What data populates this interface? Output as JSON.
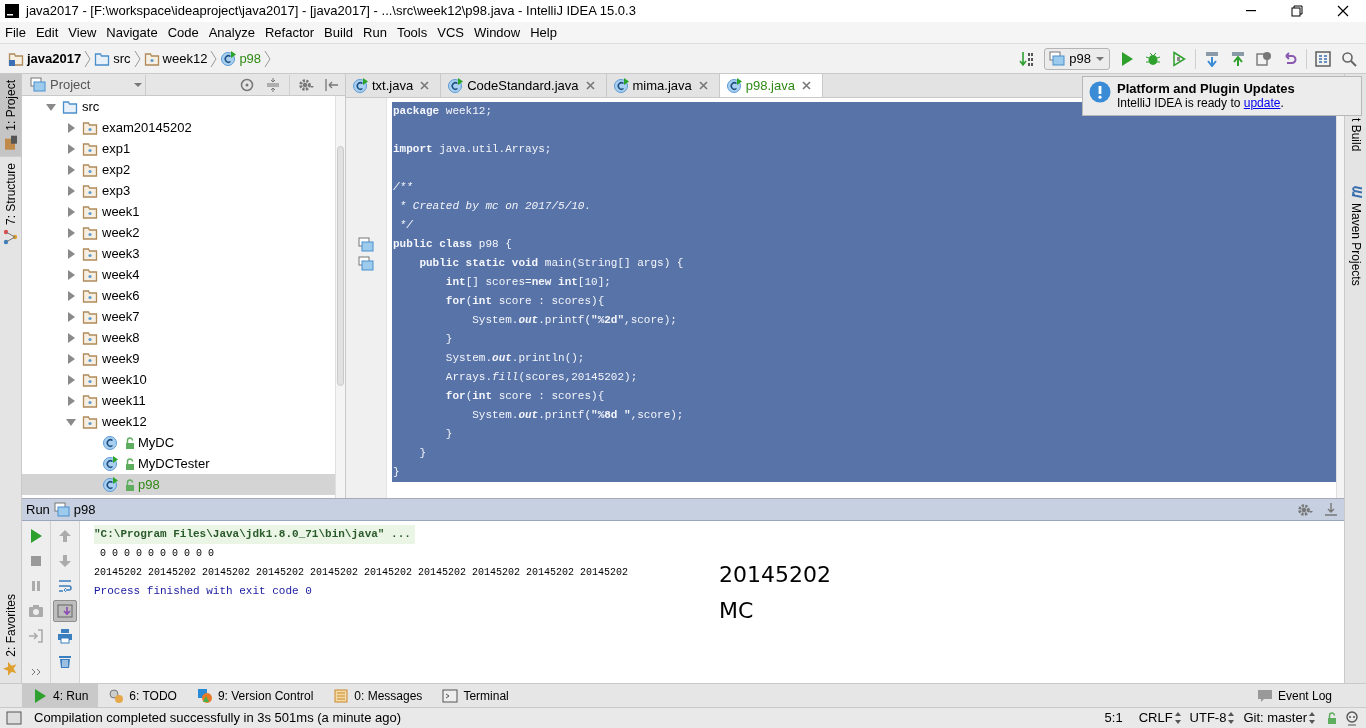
{
  "window": {
    "title": "java2017 - [F:\\workspace\\ideaproject\\java2017] - [java2017] - ...\\src\\week12\\p98.java - IntelliJ IDEA 15.0.3"
  },
  "menu": [
    "File",
    "Edit",
    "View",
    "Navigate",
    "Code",
    "Analyze",
    "Refactor",
    "Build",
    "Run",
    "Tools",
    "VCS",
    "Window",
    "Help"
  ],
  "breadcrumbs": [
    {
      "label": "java2017",
      "kind": "module",
      "color": "#000000"
    },
    {
      "label": "src",
      "kind": "source",
      "color": "#000000"
    },
    {
      "label": "week12",
      "kind": "package",
      "color": "#000000"
    },
    {
      "label": "p98",
      "kind": "runnable",
      "color": "#2f8a14"
    }
  ],
  "run_config": "p98",
  "left_top_tabs": [
    {
      "label": "1: Project",
      "kind": "project",
      "selected": true
    },
    {
      "label": "7: Structure",
      "kind": "structure",
      "selected": false
    }
  ],
  "left_bottom_tabs": [
    {
      "label": "2: Favorites",
      "kind": "favorites",
      "selected": false
    }
  ],
  "right_tabs": [
    {
      "label": "t Build",
      "kind": "plain"
    },
    {
      "label": "Maven Projects",
      "kind": "maven"
    }
  ],
  "project_panel": {
    "title": "Project",
    "tree": [
      {
        "label": "src",
        "kind": "source",
        "expanded": true,
        "selected": false,
        "vcs_added": false,
        "children": [
          {
            "label": "exam20145202",
            "kind": "package",
            "expanded": false,
            "selected": false,
            "vcs_added": false
          },
          {
            "label": "exp1",
            "kind": "package",
            "expanded": false,
            "selected": false,
            "vcs_added": false
          },
          {
            "label": "exp2",
            "kind": "package",
            "expanded": false,
            "selected": false,
            "vcs_added": false
          },
          {
            "label": "exp3",
            "kind": "package",
            "expanded": false,
            "selected": false,
            "vcs_added": false
          },
          {
            "label": "week1",
            "kind": "package",
            "expanded": false,
            "selected": false,
            "vcs_added": false
          },
          {
            "label": "week2",
            "kind": "package",
            "expanded": false,
            "selected": false,
            "vcs_added": false
          },
          {
            "label": "week3",
            "kind": "package",
            "expanded": false,
            "selected": false,
            "vcs_added": false
          },
          {
            "label": "week4",
            "kind": "package",
            "expanded": false,
            "selected": false,
            "vcs_added": false
          },
          {
            "label": "week6",
            "kind": "package",
            "expanded": false,
            "selected": false,
            "vcs_added": false
          },
          {
            "label": "week7",
            "kind": "package",
            "expanded": false,
            "selected": false,
            "vcs_added": false
          },
          {
            "label": "week8",
            "kind": "package",
            "expanded": false,
            "selected": false,
            "vcs_added": false
          },
          {
            "label": "week9",
            "kind": "package",
            "expanded": false,
            "selected": false,
            "vcs_added": false
          },
          {
            "label": "week10",
            "kind": "package",
            "expanded": false,
            "selected": false,
            "vcs_added": false
          },
          {
            "label": "week11",
            "kind": "package",
            "expanded": false,
            "selected": false,
            "vcs_added": false
          },
          {
            "label": "week12",
            "kind": "package",
            "expanded": true,
            "selected": false,
            "vcs_added": false,
            "children": [
              {
                "label": "MyDC",
                "kind": "class",
                "selected": false,
                "vcs_added": false
              },
              {
                "label": "MyDCTester",
                "kind": "runnable",
                "selected": false,
                "vcs_added": false
              },
              {
                "label": "p98",
                "kind": "runnable",
                "selected": true,
                "vcs_added": true
              }
            ]
          }
        ]
      }
    ]
  },
  "editor": {
    "tabs": [
      {
        "label": "txt.java",
        "selected": false,
        "color": "#000000"
      },
      {
        "label": "CodeStandard.java",
        "selected": false,
        "color": "#000000"
      },
      {
        "label": "mima.java",
        "selected": false,
        "color": "#000000"
      },
      {
        "label": "p98.java",
        "selected": true,
        "color": "#2f8a14"
      }
    ],
    "selected": true,
    "lines": [
      {
        "tokens": [
          {
            "kind": "keyword",
            "text": "package"
          },
          {
            "kind": "plain",
            "text": " week12;"
          }
        ]
      },
      {
        "kind": "blank"
      },
      {
        "tokens": [
          {
            "kind": "keyword",
            "text": "import"
          },
          {
            "kind": "plain",
            "text": " java.util.Arrays;"
          }
        ]
      },
      {
        "kind": "blank"
      },
      {
        "tokens": [
          {
            "kind": "comment",
            "text": "/**"
          }
        ]
      },
      {
        "tokens": [
          {
            "kind": "comment",
            "text": " * Created by mc on 2017/5/10."
          }
        ]
      },
      {
        "tokens": [
          {
            "kind": "comment",
            "text": " */"
          }
        ]
      },
      {
        "run_marker": true,
        "tokens": [
          {
            "kind": "keyword",
            "text": "public class"
          },
          {
            "kind": "plain",
            "text": " p98 {"
          }
        ]
      },
      {
        "run_marker": true,
        "tokens": [
          {
            "kind": "keyword",
            "text": "    public static void"
          },
          {
            "kind": "plain",
            "text": " main(String[] args) {"
          }
        ]
      },
      {
        "tokens": [
          {
            "kind": "keyword",
            "text": "        int"
          },
          {
            "kind": "plain",
            "text": "[] scores="
          },
          {
            "kind": "keyword",
            "text": "new int"
          },
          {
            "kind": "plain",
            "text": "[10];"
          }
        ]
      },
      {
        "tokens": [
          {
            "kind": "keyword",
            "text": "        for"
          },
          {
            "kind": "plain",
            "text": "("
          },
          {
            "kind": "keyword",
            "text": "int"
          },
          {
            "kind": "plain",
            "text": " score : scores){"
          }
        ]
      },
      {
        "tokens": [
          {
            "kind": "plain",
            "text": "            System."
          },
          {
            "kind": "static",
            "text": "out"
          },
          {
            "kind": "plain",
            "text": ".printf("
          },
          {
            "kind": "string",
            "text": "\"%2d\""
          },
          {
            "kind": "plain",
            "text": ",score);"
          }
        ]
      },
      {
        "tokens": [
          {
            "kind": "plain",
            "text": "        }"
          }
        ]
      },
      {
        "tokens": [
          {
            "kind": "plain",
            "text": "        System."
          },
          {
            "kind": "static",
            "text": "out"
          },
          {
            "kind": "plain",
            "text": ".println();"
          }
        ]
      },
      {
        "tokens": [
          {
            "kind": "plain",
            "text": "        Arrays."
          },
          {
            "kind": "italic",
            "text": "fill"
          },
          {
            "kind": "plain",
            "text": "(scores,20145202);"
          }
        ]
      },
      {
        "tokens": [
          {
            "kind": "keyword",
            "text": "        for"
          },
          {
            "kind": "plain",
            "text": "("
          },
          {
            "kind": "keyword",
            "text": "int"
          },
          {
            "kind": "plain",
            "text": " score : scores){"
          }
        ]
      },
      {
        "tokens": [
          {
            "kind": "plain",
            "text": "            System."
          },
          {
            "kind": "static",
            "text": "out"
          },
          {
            "kind": "plain",
            "text": ".printf("
          },
          {
            "kind": "string",
            "text": "\"%8d \""
          },
          {
            "kind": "plain",
            "text": ",score);"
          }
        ]
      },
      {
        "tokens": [
          {
            "kind": "plain",
            "text": "        }"
          }
        ]
      },
      {
        "tokens": [
          {
            "kind": "plain",
            "text": "    }"
          }
        ]
      },
      {
        "tokens": [
          {
            "kind": "plain",
            "text": "}"
          }
        ]
      }
    ]
  },
  "notification": {
    "title": "Platform and Plugin Updates",
    "text": "IntelliJ IDEA is ready to ",
    "link": "update",
    "after": "."
  },
  "run_panel": {
    "title": "Run",
    "config": "p98",
    "tools_left": [
      {
        "kind": "rerun",
        "disabled": false,
        "pressed": false
      },
      {
        "kind": "stop",
        "disabled": true,
        "pressed": false
      },
      {
        "kind": "pause",
        "disabled": true,
        "pressed": false
      },
      {
        "kind": "dump",
        "disabled": true,
        "pressed": false
      },
      {
        "kind": "exit",
        "disabled": true,
        "pressed": false
      },
      {
        "kind": "more",
        "disabled": false,
        "pressed": false
      }
    ],
    "tools_right": [
      {
        "kind": "up",
        "disabled": true,
        "pressed": false
      },
      {
        "kind": "down",
        "disabled": true,
        "pressed": false
      },
      {
        "kind": "wrap",
        "disabled": false,
        "pressed": false
      },
      {
        "kind": "scroll",
        "disabled": false,
        "pressed": true
      },
      {
        "kind": "print",
        "disabled": false,
        "pressed": false
      },
      {
        "kind": "clear",
        "disabled": false,
        "pressed": false
      }
    ],
    "console": [
      {
        "kind": "command",
        "text": "\"C:\\Program Files\\Java\\jdk1.8.0_71\\bin\\java\" ..."
      },
      {
        "kind": "output",
        "text": " 0 0 0 0 0 0 0 0 0 0"
      },
      {
        "kind": "output",
        "text": "20145202 20145202 20145202 20145202 20145202 20145202 20145202 20145202 20145202 20145202"
      },
      {
        "kind": "system",
        "text": "Process finished with exit code 0"
      }
    ],
    "overlay": [
      "20145202",
      "MC"
    ]
  },
  "tool_windows": [
    {
      "label": "4: Run",
      "kind": "run",
      "selected": true
    },
    {
      "label": "6: TODO",
      "kind": "todo",
      "selected": false
    },
    {
      "label": "9: Version Control",
      "kind": "vcs",
      "selected": false
    },
    {
      "label": "0: Messages",
      "kind": "messages",
      "selected": false
    },
    {
      "label": "Terminal",
      "kind": "terminal",
      "selected": false
    }
  ],
  "event_log": "Event Log",
  "status": {
    "message": "Compilation completed successfully in 3s 501ms (a minute ago)",
    "position": "5:1",
    "line_separator": "CRLF",
    "encoding": "UTF-8",
    "vcs": "Git: master"
  }
}
